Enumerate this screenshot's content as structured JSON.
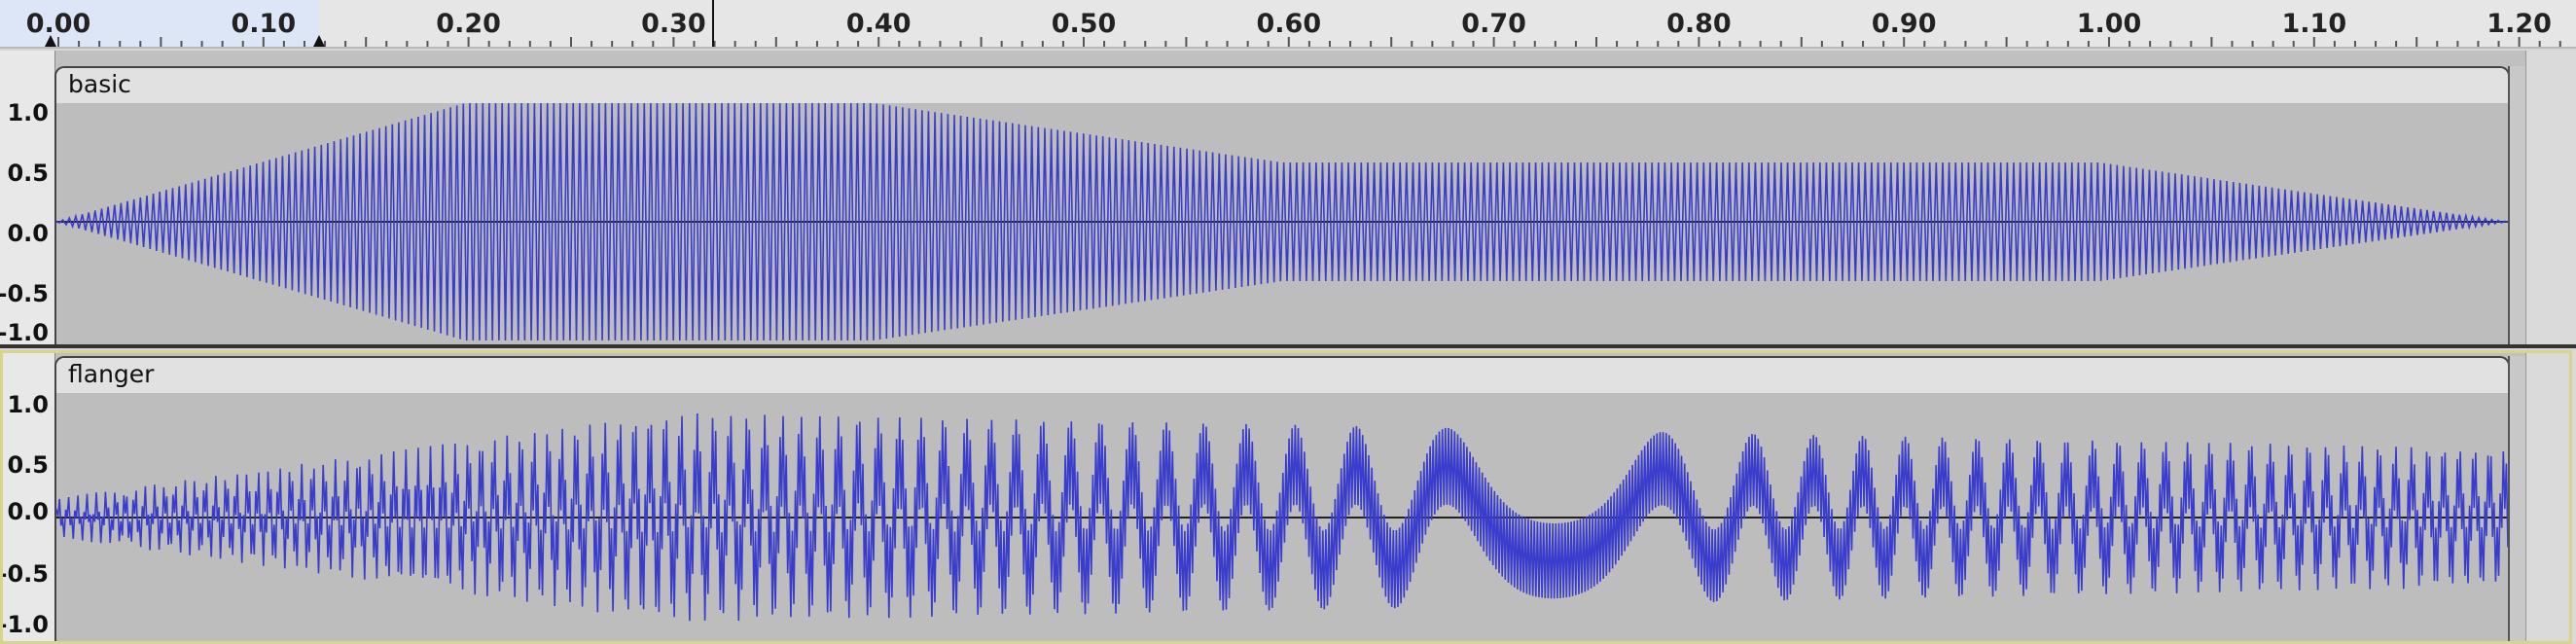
{
  "ruler": {
    "labels": [
      "0.00",
      "0.10",
      "0.20",
      "0.30",
      "0.40",
      "0.50",
      "0.60",
      "0.70",
      "0.80",
      "0.90",
      "1.00",
      "1.10",
      "1.20"
    ]
  },
  "tracks": [
    {
      "name": "basic",
      "scale": [
        "1.0",
        "0.5",
        "0.0",
        "-0.5",
        "-1.0"
      ]
    },
    {
      "name": "flanger",
      "scale": [
        "1.0",
        "0.5",
        "0.0",
        "-0.5",
        "-1.0"
      ]
    }
  ],
  "colors": {
    "waveform": "#3a3ccc",
    "accent": "#2f36c8"
  }
}
